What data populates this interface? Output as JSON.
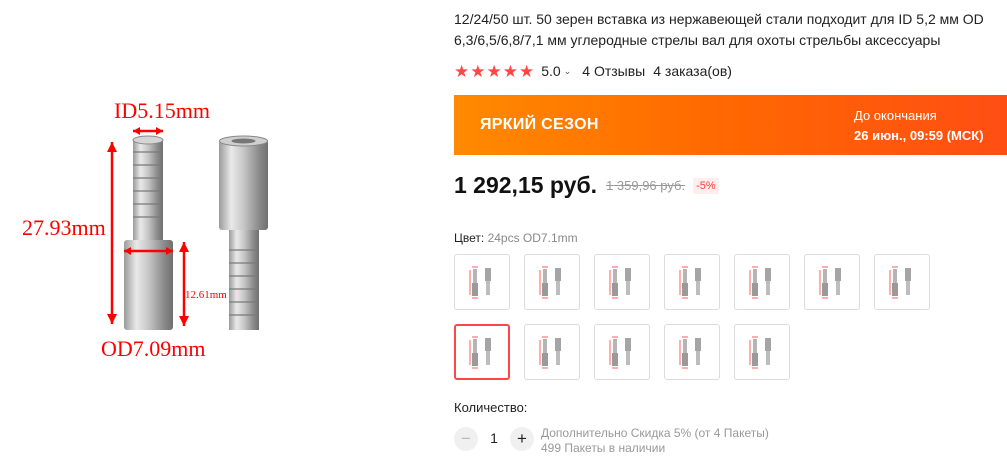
{
  "product": {
    "title": "12/24/50 шт. 50 зерен вставка из нержавеющей стали подходит для ID 5,2 мм OD 6,3/6,5/6,8/7,1 мм углеродные стрелы вал для охоты стрельбы аксессуары",
    "rating": {
      "stars": 5,
      "value": "5.0",
      "reviews": "4 Отзывы",
      "orders": "4 заказа(ов)",
      "star_color": "#ff4747"
    }
  },
  "image": {
    "id_label": "ID5.15mm",
    "length_label": "27.93mm",
    "od_label": "OD7.09mm",
    "small_label": "12.61mm",
    "annotation_color": "#ff0000"
  },
  "banner": {
    "title": "ЯРКИЙ СЕЗОН",
    "until_label": "До окончания",
    "until_date": "26 июн., 09:59 (МСК)"
  },
  "price": {
    "current": "1 292,15 руб.",
    "old": "1 359,96 руб.",
    "discount": "-5%"
  },
  "variant": {
    "label": "Цвет:",
    "selected": "24pcs OD7.1mm",
    "selected_index": 7,
    "count": 12
  },
  "quantity": {
    "label": "Количество:",
    "value": "1",
    "minus_icon": "−",
    "plus_icon": "+",
    "discount_note": "Дополнительно Скидка 5% (от 4 Пакеты)",
    "stock_note": "499 Пакеты в наличии"
  }
}
